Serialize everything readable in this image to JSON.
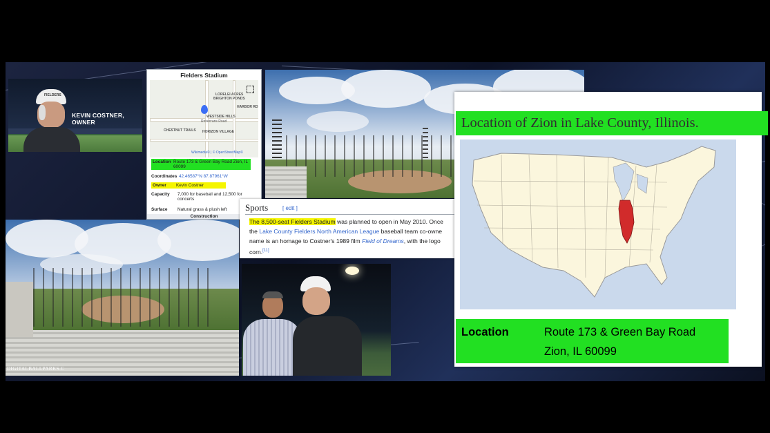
{
  "owner_banner": {
    "caption": "KEVIN COSTNER, OWNER",
    "cap_text": "FIELDERS"
  },
  "infobox": {
    "title": "Fielders Stadium",
    "map_labels": [
      "LORELEI ACRES",
      "BRIGHTON PONDS",
      "HARBOR RD",
      "WESTSIDE HILLS",
      "Rosecrans Road",
      "CHESTNUT TRAILS",
      "HORIZON VILLAGE"
    ],
    "map_credit": "Wikimedia© | © OpenStreetMap©",
    "rows": [
      {
        "key": "Location",
        "value": "Route 173 & Green Bay Road Zion, IL 60099"
      },
      {
        "key": "Coordinates",
        "value": "42.46587°N 87.87961°W"
      },
      {
        "key": "Owner",
        "value": "Kevin Costner"
      },
      {
        "key": "Capacity",
        "value": "7,000 for baseball and 12,500 for concerts"
      },
      {
        "key": "Surface",
        "value": "Natural grass & plush left"
      }
    ],
    "section": "Construction"
  },
  "sports": {
    "heading": "Sports",
    "edit": "[ edit ]",
    "line1_highlight": "The 8,500-seat Fielders Stadium",
    "line1_rest": " was planned to open in May 2010. Once",
    "line2_pre": "the ",
    "line2_link": "Lake County Fielders North American League",
    "line2_rest": " baseball team co-owne",
    "line3_pre": "name is an homage to Costner's 1989 film ",
    "line3_link": "Field of Dreams",
    "line3_rest": ", with the logo",
    "line4": "corn.",
    "cite": "[11]"
  },
  "map_panel": {
    "title": "Location of Zion in Lake County, Illinois.",
    "location_label": "Location",
    "location_line1": "Route 173 & Green Bay Road",
    "location_line2": "Zion, IL 60099"
  },
  "watermark": "DIGITALBALLPARKS.C",
  "colors": {
    "highlight_green": "#22e022",
    "highlight_yellow": "#f5f500",
    "illinois_red": "#d12b2b"
  }
}
